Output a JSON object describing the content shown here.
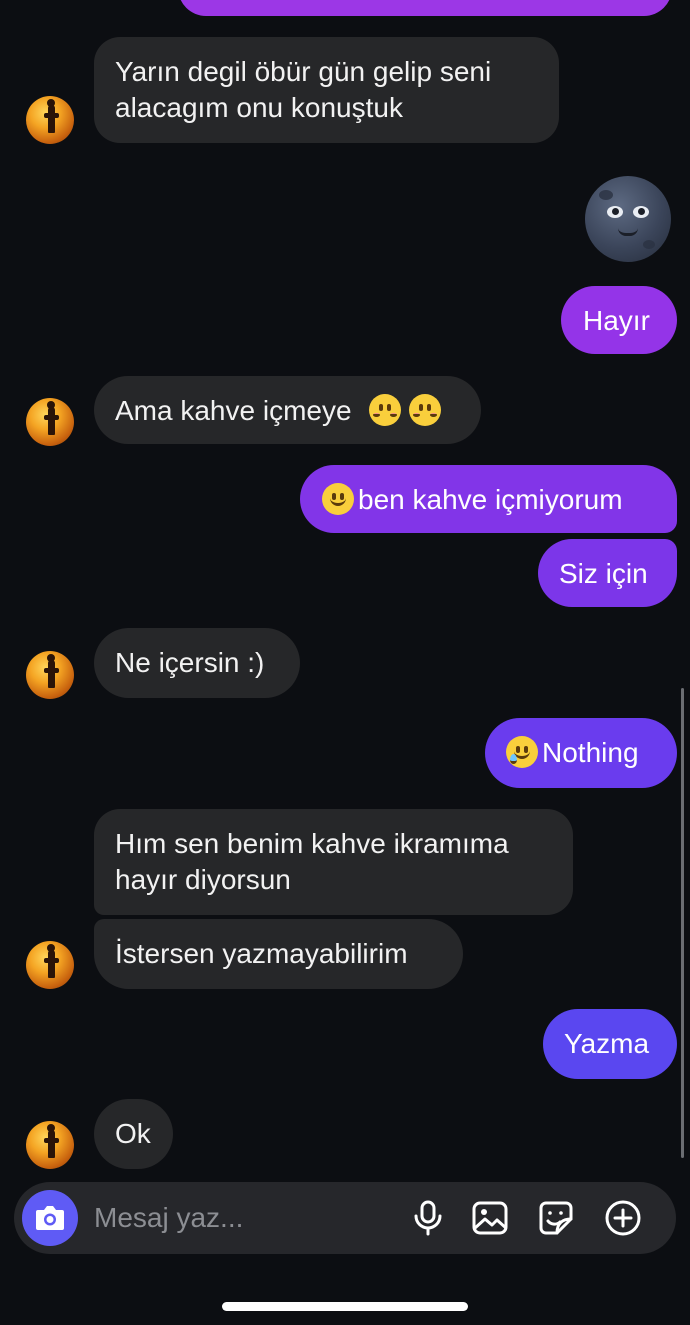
{
  "messages": [
    {
      "dir": "in",
      "text": "Yarın degil öbür gün gelip seni\nalacagım onu konuştuk"
    },
    {
      "dir": "out",
      "emoji": "new-moon-face"
    },
    {
      "dir": "out",
      "text": "Hayır"
    },
    {
      "dir": "in",
      "text": "Ama kahve içmeye",
      "suffix_emoji": "smiling-face-x2"
    },
    {
      "dir": "out",
      "prefix_emoji": "slightly-smiling-face",
      "text": "ben kahve içmiyorum"
    },
    {
      "dir": "out",
      "text": "Siz için"
    },
    {
      "dir": "in",
      "text": "Ne içersin :)"
    },
    {
      "dir": "out",
      "prefix_emoji": "smiling-face-with-tear",
      "text": "Nothing"
    },
    {
      "dir": "in",
      "text": "Hım sen benim kahve ikramıma\nhayır diyorsun"
    },
    {
      "dir": "in",
      "text": "İstersen yazmayabilirim"
    },
    {
      "dir": "out",
      "text": "Yazma"
    },
    {
      "dir": "in",
      "text": "Ok"
    }
  ],
  "composer": {
    "placeholder": "Mesaj yaz...",
    "icons": [
      "camera-icon",
      "microphone-icon",
      "gallery-icon",
      "sticker-icon",
      "plus-icon"
    ]
  },
  "colors": {
    "background": "#0c0e12",
    "incoming_bubble": "#262729",
    "outgoing_gradient_top": "#9b3df0",
    "outgoing_gradient_bottom": "#5a4cf2",
    "camera_button": "#5f5bf5"
  }
}
